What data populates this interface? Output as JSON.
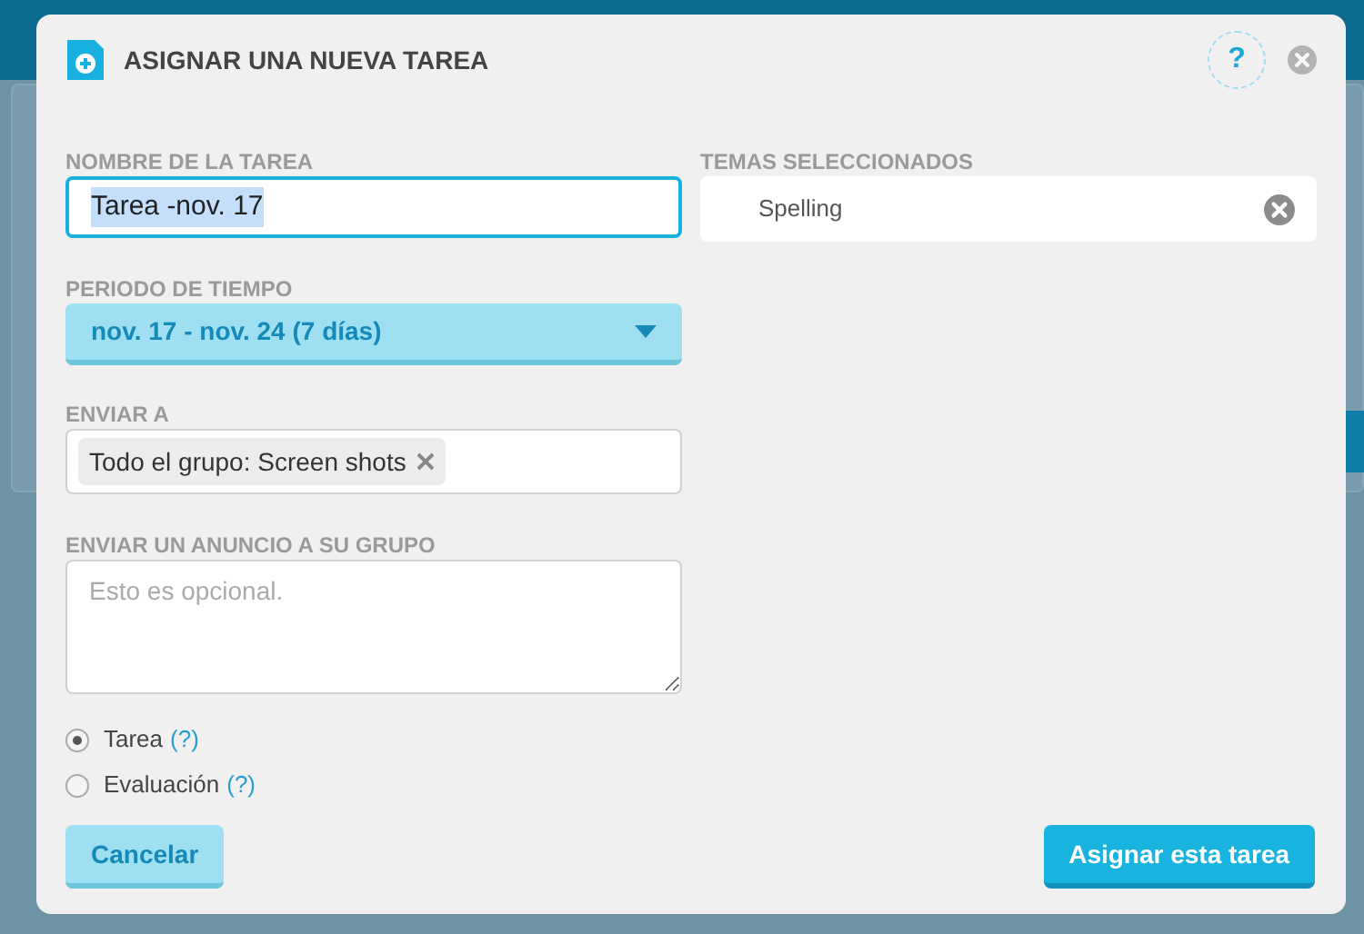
{
  "dialog": {
    "title": "ASIGNAR UNA NUEVA TAREA",
    "help": "?"
  },
  "task_name": {
    "label": "NOMBRE DE LA TAREA",
    "value": "Tarea -nov. 17",
    "focused": true,
    "text_selected": true
  },
  "topics": {
    "label": "TEMAS SELECCIONADOS",
    "items": [
      {
        "label": "Spelling"
      }
    ]
  },
  "period": {
    "label": "PERIODO DE TIEMPO",
    "value": "nov. 17 - nov. 24 (7 días)"
  },
  "send_to": {
    "label": "ENVIAR A",
    "tokens": [
      {
        "label": "Todo el grupo: Screen shots"
      }
    ]
  },
  "announcement": {
    "label": "ENVIAR UN ANUNCIO A SU GRUPO",
    "placeholder": "Esto es opcional."
  },
  "types": [
    {
      "label": "Tarea",
      "help": "(?)",
      "selected": true
    },
    {
      "label": "Evaluación",
      "help": "(?)",
      "selected": false
    }
  ],
  "buttons": [
    {
      "label": "Cancelar",
      "kind": "secondary"
    },
    {
      "label": "Asignar esta tarea",
      "kind": "primary"
    }
  ]
}
